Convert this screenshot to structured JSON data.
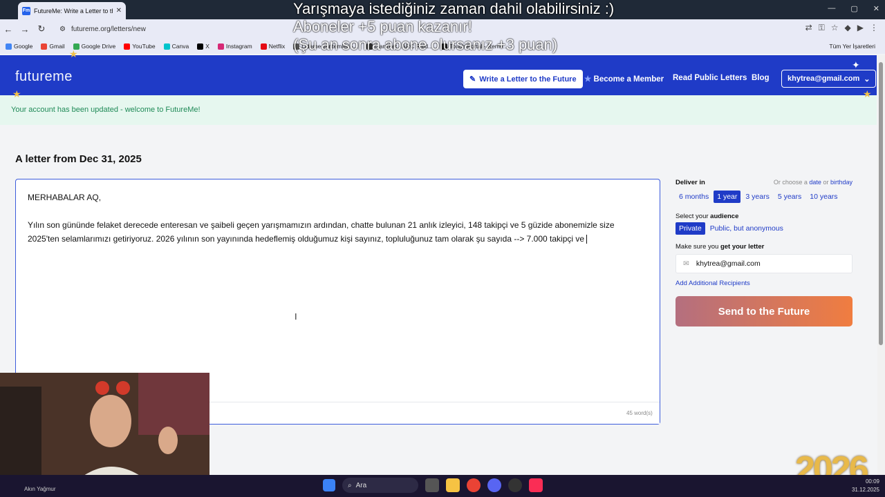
{
  "browser": {
    "tab_title": "FutureMe: Write a Letter to the Future",
    "tab_favicon": "Fm",
    "url": "futureme.org/letters/new",
    "bookmarks": [
      {
        "label": "Google",
        "color": "#4285f4"
      },
      {
        "label": "Gmail",
        "color": "#ea4335"
      },
      {
        "label": "Google Drive",
        "color": "#34a853"
      },
      {
        "label": "YouTube",
        "color": "#ff0000"
      },
      {
        "label": "Canva",
        "color": "#00c4cc"
      },
      {
        "label": "X",
        "color": "#000000"
      },
      {
        "label": "Instagram",
        "color": "#d62976"
      },
      {
        "label": "Netflix",
        "color": "#e50914"
      },
      {
        "label": "Ödeme yöntemleri -...",
        "color": "#555555"
      },
      {
        "label": "Ganimet - ARC Raid...",
        "color": "#333333"
      },
      {
        "label": "Touch Portal - Remo...",
        "color": "#222222"
      }
    ],
    "all_bookmarks": "Tüm Yer İşaretleri"
  },
  "stream_overlay": {
    "line1": "Yarışmaya istediğiniz zaman dahil olabilirsiniz :)",
    "line2": "Aboneler +5 puan kazanır!",
    "line3": "(Şu an sonra abone olursanız +3 puan)"
  },
  "site": {
    "logo": "futureme",
    "nav": {
      "write": "Write a Letter to the Future",
      "member": "Become a Member",
      "public": "Read Public Letters",
      "blog": "Blog",
      "account": "khytrea@gmail.com"
    },
    "flash": "Your account has been updated - welcome to FutureMe!",
    "letter_title": "A letter from Dec 31, 2025",
    "letter_body": "MERHABALAR AQ,\n\nYılın son gününde felaket derecede enteresan ve şaibeli geçen yarışmamızın ardından, chatte bulunan 21 anlık izleyici, 148 takipçi ve 5 güzide abonemizle size 2025'ten selamlarımızı getiriyoruz. 2026 yılının son yayınında hedeflemiş olduğumuz kişi sayınız, topluluğunuz tam olarak şu sayıda --> 7.000 takipçi ve ",
    "word_count": "45 word(s)",
    "deliver": {
      "label": "Deliver in",
      "choose_prefix": "Or choose a",
      "choose_date": "date",
      "choose_or": "or",
      "choose_birthday": "birthday",
      "options": [
        "6 months",
        "1 year",
        "3 years",
        "5 years",
        "10 years"
      ],
      "selected": "1 year"
    },
    "audience": {
      "label_prefix": "Select your",
      "label_strong": "audience",
      "options": [
        "Private",
        "Public, but anonymous"
      ],
      "selected": "Private"
    },
    "recipient": {
      "label_prefix": "Make sure you",
      "label_strong": "get your letter",
      "email": "khytrea@gmail.com",
      "add": "Add Additional Recipients"
    },
    "send": "Send to the Future"
  },
  "taskbar": {
    "search": "Ara",
    "time": "00:09",
    "date": "31.12.2025",
    "user": "Akın Yağmur"
  },
  "decoration": {
    "year": "2026"
  }
}
